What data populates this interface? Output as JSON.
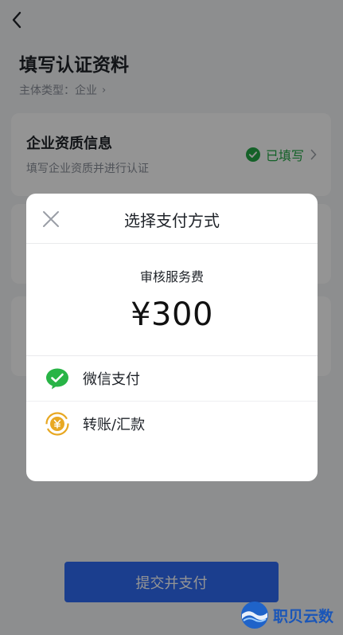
{
  "header": {
    "title": "填写认证资料",
    "entity_type": "主体类型：企业",
    "entity_chevron": "›"
  },
  "cards": [
    {
      "title": "企业资质信息",
      "description": "填写企业资质并进行认证",
      "status": "已填写"
    }
  ],
  "footer": {
    "submit_label": "提交并支付"
  },
  "modal": {
    "title": "选择支付方式",
    "fee_label": "审核服务费",
    "fee_amount": "¥300",
    "options": [
      {
        "label": "微信支付",
        "icon": "wechat-pay-icon"
      },
      {
        "label": "转账/汇款",
        "icon": "bank-transfer-icon"
      }
    ]
  },
  "watermark": {
    "text": "职贝云数"
  },
  "colors": {
    "accent": "#2f6bf5",
    "success": "#23a845",
    "wechat": "#28b446",
    "transfer": "#e8a822"
  }
}
